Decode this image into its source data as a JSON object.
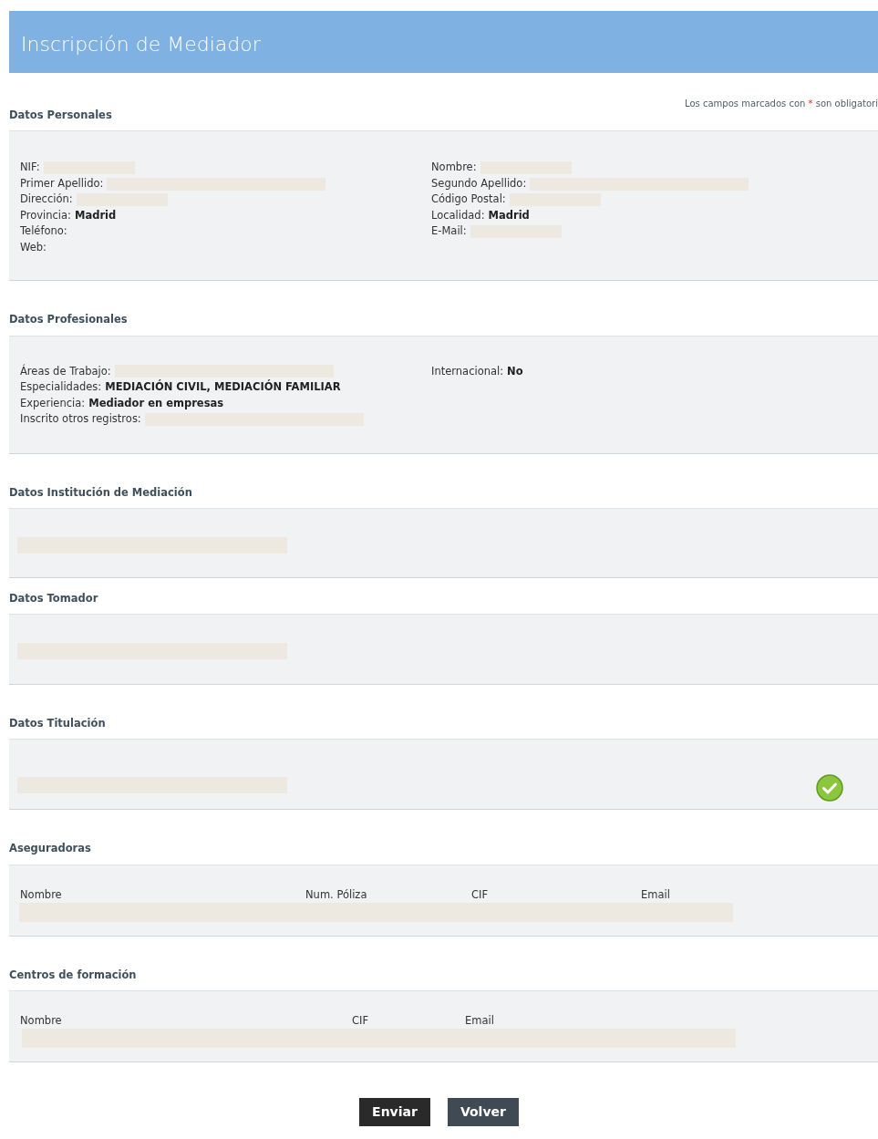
{
  "header": {
    "title": "Inscripción de Mediador"
  },
  "required_note": {
    "before": "Los campos marcados con",
    "mark": "*",
    "after": "son obligatori"
  },
  "sections": [
    {
      "kind": "fields",
      "title": "Datos Personales",
      "columns": [
        [
          {
            "label": "NIF:",
            "redacted": true
          },
          {
            "label": "Primer Apellido:",
            "redacted": true
          },
          {
            "label": "Dirección:",
            "redacted": true
          },
          {
            "label": "Provincia:",
            "value": "Madrid",
            "redacted": false
          },
          {
            "label": "Teléfono:",
            "redacted": false
          },
          {
            "label": "Web:",
            "redacted": false
          }
        ],
        [
          {
            "label": "Nombre:",
            "redacted": true
          },
          {
            "label": "Segundo Apellido:",
            "redacted": true
          },
          {
            "label": "Código Postal:",
            "redacted": true
          },
          {
            "label": "Localidad:",
            "value": "Madrid",
            "redacted": false
          },
          {
            "label": "E-Mail:",
            "redacted": true
          }
        ]
      ]
    },
    {
      "kind": "fields",
      "title": "Datos Profesionales",
      "columns": [
        [
          {
            "label": "Áreas de Trabajo:",
            "redacted": true
          },
          {
            "label": "Especialidades:",
            "value": "MEDIACIÓN CIVIL, MEDIACIÓN FAMILIAR",
            "redacted": false
          },
          {
            "label": "Experiencia:",
            "value": "Mediador en empresas",
            "redacted": false
          },
          {
            "label": "Inscrito otros registros:",
            "redacted": true
          }
        ],
        [
          {
            "label": "Internacional:",
            "value": "No",
            "redacted": false
          }
        ]
      ]
    },
    {
      "kind": "block",
      "title": "Datos Institución de Mediación",
      "verified": false
    },
    {
      "kind": "block",
      "title": "Datos Tomador",
      "verified": false
    },
    {
      "kind": "block",
      "title": "Datos Titulación",
      "verified": true
    },
    {
      "kind": "table",
      "title": "Aseguradoras",
      "columns": [
        "Nombre",
        "Num. Póliza",
        "CIF",
        "Email"
      ]
    },
    {
      "kind": "table",
      "title": "Centros de formación",
      "columns": [
        "Nombre",
        "CIF",
        "Email"
      ]
    }
  ],
  "buttons": [
    {
      "label": "Enviar",
      "kind": "primary"
    },
    {
      "label": "Volver",
      "kind": "secondary"
    }
  ]
}
